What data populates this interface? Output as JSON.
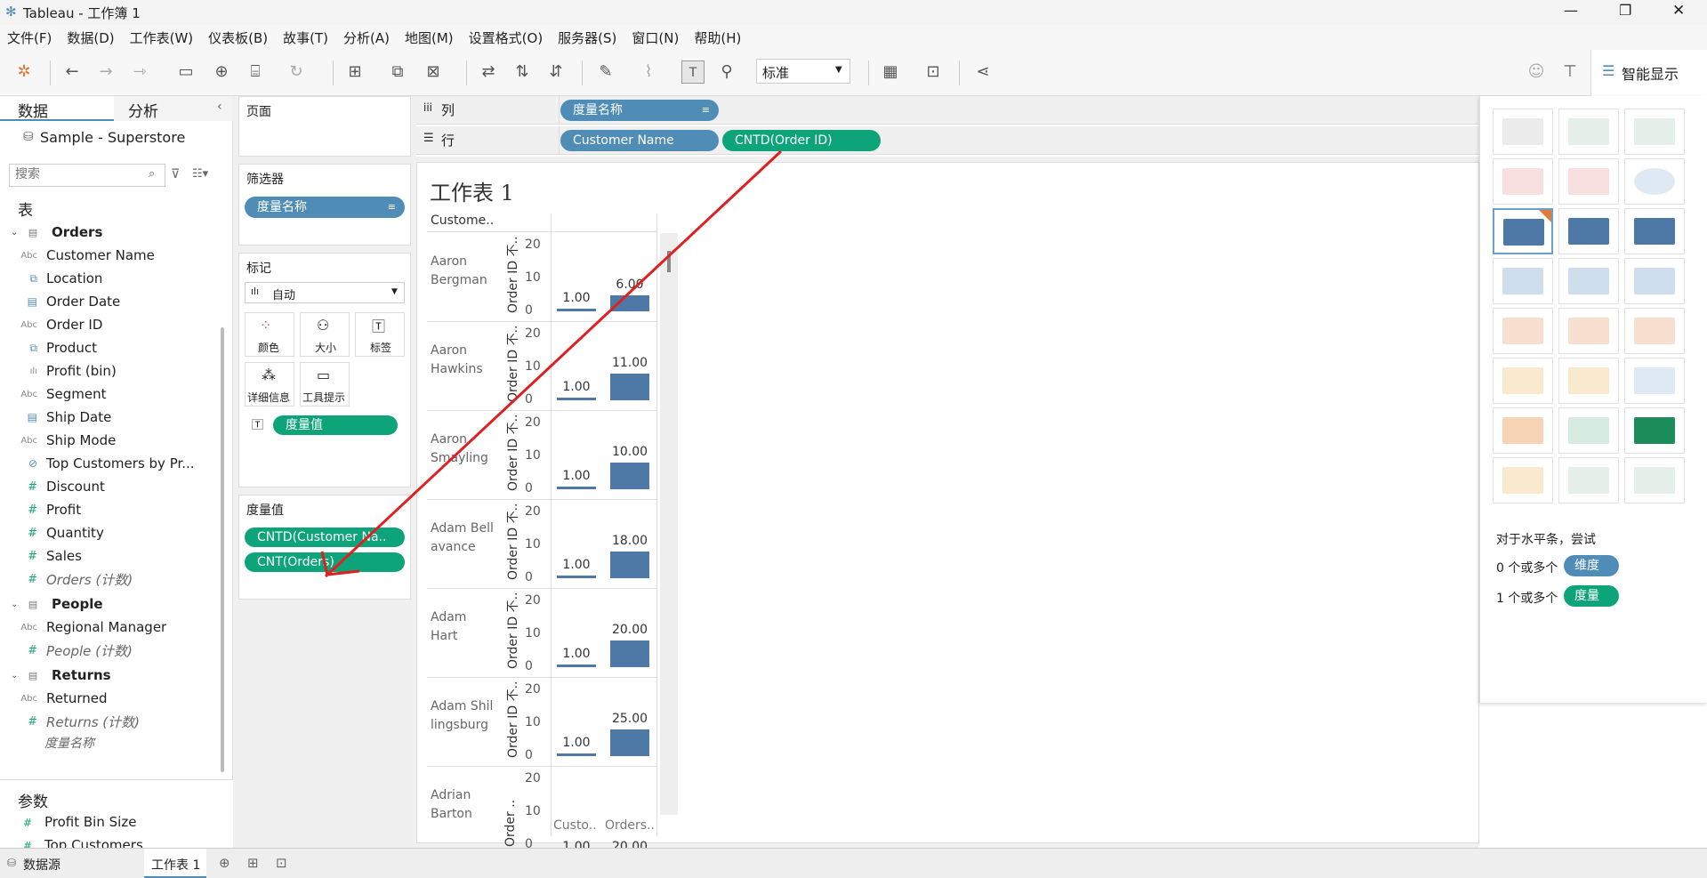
{
  "window": {
    "title": "Tableau - 工作簿 1",
    "min": "—",
    "max": "❐",
    "close": "✕"
  },
  "menu": [
    "文件(F)",
    "数据(D)",
    "工作表(W)",
    "仪表板(B)",
    "故事(T)",
    "分析(A)",
    "地图(M)",
    "设置格式(O)",
    "服务器(S)",
    "窗口(N)",
    "帮助(H)"
  ],
  "toolbar": {
    "fit": "标准",
    "show_me": "智能显示"
  },
  "left": {
    "tab_data": "数据",
    "tab_analysis": "分析",
    "datasource": "Sample - Superstore",
    "search_placeholder": "搜索",
    "tables_header": "表",
    "groups": [
      {
        "name": "Orders",
        "fields": [
          [
            "Abc",
            "Customer Name"
          ],
          [
            "⧉",
            "Location"
          ],
          [
            "▤",
            "Order Date"
          ],
          [
            "Abc",
            "Order ID"
          ],
          [
            "⧉",
            "Product"
          ],
          [
            "ılı",
            "Profit (bin)"
          ],
          [
            "Abc",
            "Segment"
          ],
          [
            "▤",
            "Ship Date"
          ],
          [
            "Abc",
            "Ship Mode"
          ],
          [
            "⊘",
            "Top Customers by Pr..."
          ],
          [
            "#",
            "Discount"
          ],
          [
            "#",
            "Profit"
          ],
          [
            "#",
            "Quantity"
          ],
          [
            "#",
            "Sales"
          ],
          [
            "#",
            "Orders (计数)"
          ]
        ]
      },
      {
        "name": "People",
        "fields": [
          [
            "Abc",
            "Regional Manager"
          ],
          [
            "#",
            "People (计数)"
          ]
        ]
      },
      {
        "name": "Returns",
        "fields": [
          [
            "Abc",
            "Returned"
          ],
          [
            "#",
            "Returns (计数)"
          ]
        ]
      }
    ],
    "partial_field": "度量名称",
    "params_header": "参数",
    "params": [
      "Profit Bin Size",
      "Top Customers"
    ]
  },
  "cards": {
    "pages": "页面",
    "filters": "筛选器",
    "filter_pill": "度量名称",
    "marks": "标记",
    "mark_type": "自动",
    "mark_buttons": [
      "颜色",
      "大小",
      "标签",
      "详细信息",
      "工具提示"
    ],
    "marks_pill": "度量值",
    "measure_values": "度量值",
    "mv_pills": [
      "CNTD(Customer Na..",
      "CNT(Orders)"
    ]
  },
  "shelves": {
    "columns_label": "列",
    "rows_label": "行",
    "columns_pills": [
      "度量名称"
    ],
    "rows_pills": [
      "Customer Name",
      "CNTD(Order ID)"
    ]
  },
  "sheet": {
    "title": "工作表 1",
    "row_header": "Custome..",
    "axis_label": "Order ID 不..",
    "axis_label_short": "Order ..",
    "ticks": [
      "20",
      "10",
      "0"
    ],
    "footer": [
      "Custo..",
      "Orders.."
    ],
    "rows": [
      {
        "name": [
          "Aaron",
          "Bergman"
        ],
        "v1": "1.00",
        "v2": "6.00"
      },
      {
        "name": [
          "Aaron",
          "Hawkins"
        ],
        "v1": "1.00",
        "v2": "11.00"
      },
      {
        "name": [
          "Aaron",
          "Smayling"
        ],
        "v1": "1.00",
        "v2": "10.00"
      },
      {
        "name": [
          "Adam Bell",
          "avance"
        ],
        "v1": "1.00",
        "v2": "18.00"
      },
      {
        "name": [
          "Adam",
          "Hart"
        ],
        "v1": "1.00",
        "v2": "20.00"
      },
      {
        "name": [
          "Adam Shil",
          "lingsburg"
        ],
        "v1": "1.00",
        "v2": "25.00"
      },
      {
        "name": [
          "Adrian",
          "Barton"
        ],
        "v1": "1.00",
        "v2": "20.00"
      }
    ]
  },
  "showme": {
    "hint": "对于水平条，尝试",
    "dim_text": "0 个或多个",
    "dim_pill": "维度",
    "mea_text": "1 个或多个",
    "mea_pill": "度量"
  },
  "bottom": {
    "datasource": "数据源",
    "sheet_tab": "工作表 1"
  },
  "colors": {
    "dimension": "#4f8db6",
    "measure": "#0ea47a",
    "bar": "#4e79a7",
    "annotation": "#e02020"
  }
}
